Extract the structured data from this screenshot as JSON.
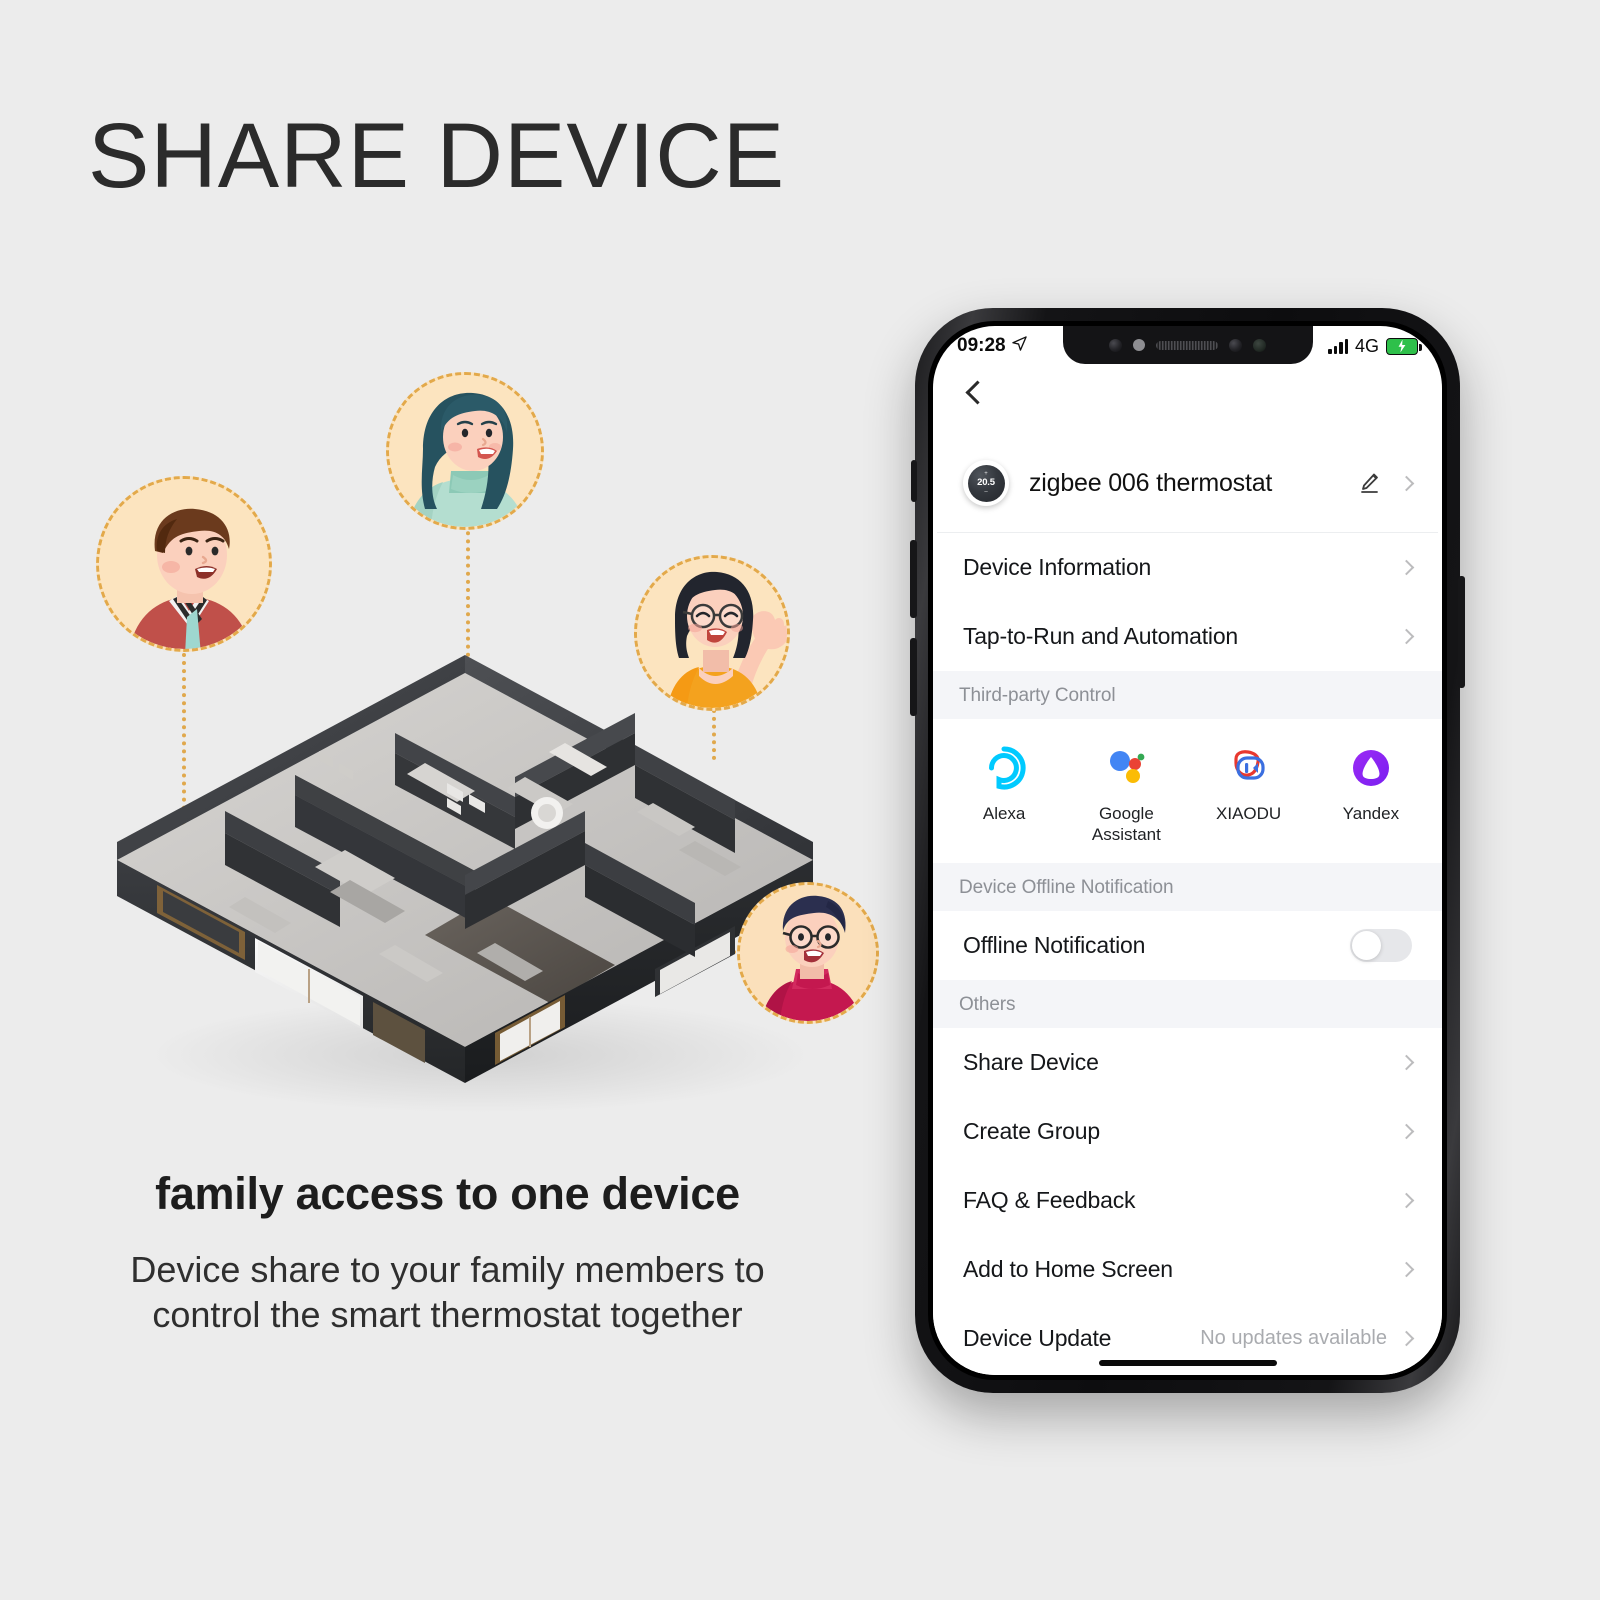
{
  "headline": "SHARE DEVICE",
  "captions": {
    "main": "family access to one device",
    "sub_line1": "Device share to your family members to",
    "sub_line2": "control the smart thermostat together"
  },
  "avatars": [
    {
      "name": "man-brown-hair-red-jacket"
    },
    {
      "name": "woman-long-dark-hair-mint-sweater"
    },
    {
      "name": "woman-glasses-orange-top-waving"
    },
    {
      "name": "man-glasses-crimson-turtleneck"
    }
  ],
  "illustration": {
    "name": "isometric-apartment-floorplan"
  },
  "phone": {
    "status_bar": {
      "time": "09:28",
      "location_icon": "location-arrow-icon",
      "signal_icon": "signal-bars-icon",
      "network": "4G",
      "battery_icon": "battery-charging-icon"
    },
    "nav": {
      "back_icon": "chevron-left-icon"
    },
    "device": {
      "icon_name": "thermostat-dial-icon",
      "dial_plus": "+",
      "dial_value": "20.5",
      "dial_minus": "–",
      "title": "zigbee 006 thermostat",
      "edit_icon": "pencil-edit-icon",
      "chevron_icon": "chevron-right-icon"
    },
    "rows_top": [
      {
        "label": "Device Information",
        "chevron": "chevron-right-icon"
      },
      {
        "label": "Tap-to-Run and Automation",
        "chevron": "chevron-right-icon"
      }
    ],
    "sections": {
      "third_party": "Third-party Control",
      "offline": "Device Offline Notification",
      "others": "Others"
    },
    "third_party_items": [
      {
        "label": "Alexa",
        "icon": "alexa-logo-icon",
        "color": "#00caff"
      },
      {
        "label": "Google\nAssistant",
        "label_l1": "Google",
        "label_l2": "Assistant",
        "icon": "google-assistant-logo-icon",
        "color": "#4285f4"
      },
      {
        "label": "XIAODU",
        "icon": "xiaodu-logo-icon",
        "color": "#e8382f"
      },
      {
        "label": "Yandex",
        "icon": "yandex-alice-logo-icon",
        "color": "#8b2ff5"
      }
    ],
    "offline_row": {
      "label": "Offline Notification",
      "toggle_state": "off",
      "toggle_icon": "toggle-switch-icon"
    },
    "rows_others": [
      {
        "label": "Share Device",
        "value": "",
        "chevron": "chevron-right-icon"
      },
      {
        "label": "Create Group",
        "value": "",
        "chevron": "chevron-right-icon"
      },
      {
        "label": "FAQ & Feedback",
        "value": "",
        "chevron": "chevron-right-icon"
      },
      {
        "label": "Add to Home Screen",
        "value": "",
        "chevron": "chevron-right-icon"
      },
      {
        "label": "Device Update",
        "value": "No updates available",
        "chevron": "chevron-right-icon"
      }
    ],
    "home_indicator": "home-indicator-bar"
  },
  "colors": {
    "background": "#ececec",
    "avatar_fill": "#fce4bf",
    "avatar_border": "#e3a94a",
    "section_bg": "#f4f5f8",
    "text_primary": "#15171a",
    "text_muted": "#8d9096"
  }
}
